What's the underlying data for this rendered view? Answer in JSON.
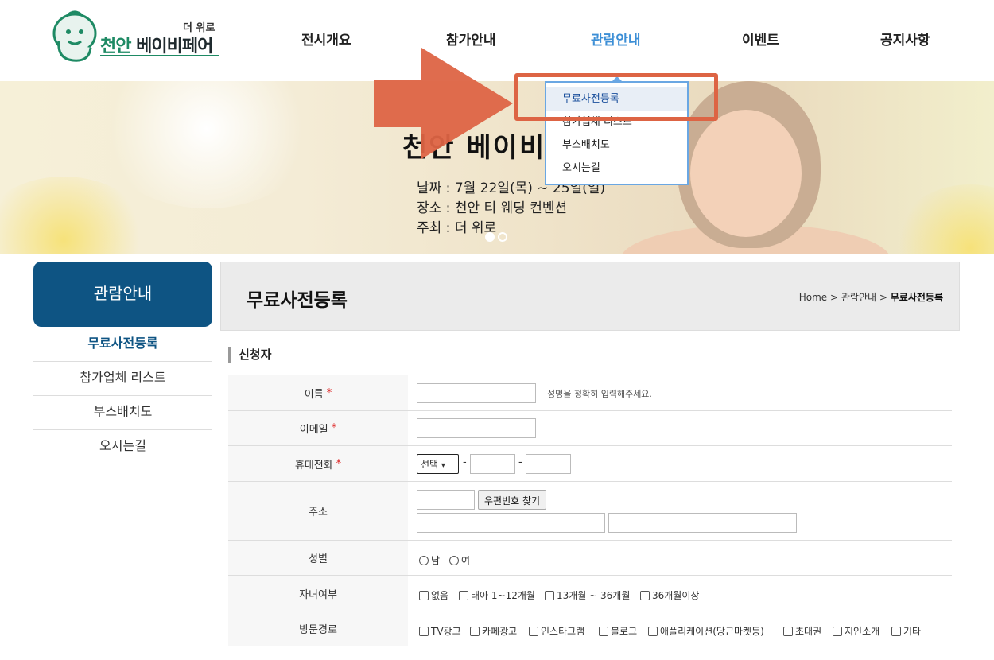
{
  "header": {
    "logo_tag": "더 위로",
    "logo_name_part1": "천안",
    "logo_name_part2": "베이비페어",
    "nav": [
      "전시개요",
      "참가안내",
      "관람안내",
      "이벤트",
      "공지사항"
    ]
  },
  "banner": {
    "title": "천안 베이비",
    "lines": [
      "날짜 : 7월 22일(목) ~ 25일(일)",
      "장소 : 천안 티 웨딩 컨벤션",
      "주최 : 더 위로"
    ]
  },
  "dropdown": {
    "items": [
      "무료사전등록",
      "참가업체 리스트",
      "부스배치도",
      "오시는길"
    ]
  },
  "sidebar": {
    "heading": "관람안내",
    "items": [
      "무료사전등록",
      "참가업체 리스트",
      "부스배치도",
      "오시는길"
    ]
  },
  "titlebar": {
    "title": "무료사전등록",
    "crumb_home": "Home",
    "crumb_sep": ">",
    "crumb_mid": "관람안내",
    "crumb_cur": "무료사전등록"
  },
  "form": {
    "section": "신청자",
    "name_label": "이름",
    "name_hint": "성명을 정확히 입력해주세요.",
    "email_label": "이메일",
    "phone_label": "휴대전화",
    "phone_select": "선택",
    "phone_dash": "-",
    "address_label": "주소",
    "postcode_button": "우편번호 찾기",
    "gender_label": "성별",
    "gender_options": [
      "남",
      "여"
    ],
    "children_label": "자녀여부",
    "children_options": [
      "없음",
      "태아 1~12개월",
      "13개월 ~ 36개월",
      "36개월이상"
    ],
    "route_label": "방문경로",
    "route_options": [
      "TV광고",
      "카페광고",
      "인스타그램",
      "블로그",
      "애플리케이션(당근마켓등)",
      "초대권",
      "지인소개",
      "기타"
    ],
    "required_mark": "*"
  },
  "colors": {
    "primary_navy": "#0e5483",
    "nav_active": "#3d8fd6",
    "annotation": "#dd6444",
    "dropdown_border": "#6aa7e3",
    "required": "#d22222"
  }
}
